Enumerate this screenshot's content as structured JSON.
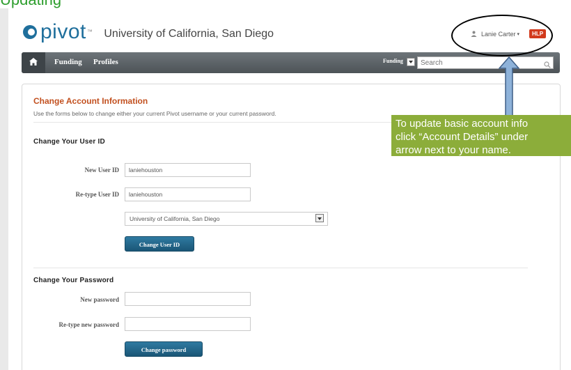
{
  "top_strip_text": "Updating",
  "brand": {
    "logo_text": "pivot",
    "trademark": "™",
    "institution": "University of California, San Diego"
  },
  "user": {
    "name": "Lanie Carter",
    "caret": "▾",
    "badge": "HLP"
  },
  "nav": {
    "items": [
      "Funding",
      "Profiles"
    ],
    "search_scope": "Funding",
    "search_placeholder": "Search"
  },
  "form": {
    "title": "Change Account Information",
    "description": "Use the forms below to change either your current Pivot username or your current password.",
    "user_id_section": {
      "title": "Change Your User ID",
      "new_label": "New User ID",
      "new_value": "laniehouston",
      "retype_label": "Re-type User ID",
      "retype_value": "laniehouston",
      "institution_selected": "University of California, San Diego",
      "button": "Change User ID"
    },
    "password_section": {
      "title": "Change Your Password",
      "new_label": "New password",
      "retype_label": "Re-type new password",
      "button": "Change password"
    }
  },
  "callout": {
    "lines": [
      "To update basic account info",
      "click “Account Details” under",
      "arrow next to your name."
    ]
  },
  "colors": {
    "accent_title": "#c2501f",
    "button": "#1f6488",
    "callout_bg": "#8cad3a",
    "brand": "#1f6f9c"
  }
}
